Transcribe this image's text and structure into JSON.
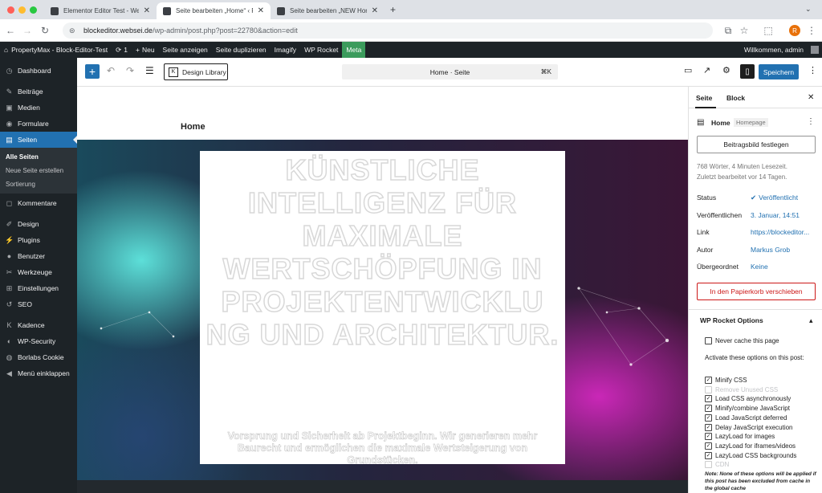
{
  "browser": {
    "tabs": [
      {
        "label": "Elementor Editor Test - Webs",
        "close": "✕"
      },
      {
        "label": "Seite bearbeiten „Home“ ‹ Pr",
        "close": "✕"
      },
      {
        "label": "Seite bearbeiten „NEW Home",
        "close": "✕"
      }
    ],
    "new_tab": "+",
    "url_host": "blockeditor.websei.de",
    "url_path": "/wp-admin/post.php?post=22780&action=edit",
    "profile_initial": "R"
  },
  "adminbar": {
    "site": "PropertyMax - Block-Editor-Test",
    "updates": "1",
    "new": "Neu",
    "view": "Seite anzeigen",
    "duplicate": "Seite duplizieren",
    "imagify": "Imagify",
    "rocket": "WP Rocket",
    "meta": "Meta",
    "welcome": "Willkommen, admin"
  },
  "sidebar": {
    "dashboard": "Dashboard",
    "posts": "Beiträge",
    "media": "Medien",
    "forms": "Formulare",
    "pages": "Seiten",
    "sub": [
      "Alle Seiten",
      "Neue Seite erstellen",
      "Sortierung"
    ],
    "comments": "Kommentare",
    "design": "Design",
    "plugins": "Plugins",
    "users": "Benutzer",
    "tools": "Werkzeuge",
    "settings": "Einstellungen",
    "seo": "SEO",
    "kadence": "Kadence",
    "security": "WP-Security",
    "borlabs": "Borlabs Cookie",
    "collapse": "Menü einklappen"
  },
  "editor": {
    "design_library": "Design Library",
    "command": "Home · Seite",
    "shortcut": "⌘K",
    "save": "Speichern"
  },
  "canvas": {
    "page_title": "Home",
    "headline": "KÜNSTLICHE INTELLIGENZ FÜR MAXIMALE WERTSCHÖPFUNG IN PROJEKTENTWICKLU NG UND ARCHITEKTUR.",
    "subline": "Vorsprung und Sicherheit ab Projektbeginn. Wir generieren mehr Baurecht und ermöglichen die maximale Wertsteigerung von Grundstücken."
  },
  "panel": {
    "tab_page": "Seite",
    "tab_block": "Block",
    "close": "✕",
    "title": "Home",
    "badge": "Homepage",
    "featured": "Beitragsbild festlegen",
    "stats": "768 Wörter, 4 Minuten Lesezeit.",
    "edited": "Zuletzt bearbeitet vor 14 Tagen.",
    "rows": [
      {
        "label": "Status",
        "value": "Veröffentlicht"
      },
      {
        "label": "Veröffentlichen",
        "value": "3. Januar, 14:51"
      },
      {
        "label": "Link",
        "value": "https://blockeditor..."
      },
      {
        "label": "Autor",
        "value": "Markus Grob"
      },
      {
        "label": "Übergeordnet",
        "value": "Keine"
      }
    ],
    "trash": "In den Papierkorb verschieben",
    "rocket_title": "WP Rocket Options",
    "never_cache": "Never cache this page",
    "activate": "Activate these options on this post:",
    "options": [
      {
        "label": "Minify CSS",
        "checked": true
      },
      {
        "label": "Remove Unused CSS",
        "checked": false,
        "disabled": true
      },
      {
        "label": "Load CSS asynchronously",
        "checked": true
      },
      {
        "label": "Minify/combine JavaScript",
        "checked": true
      },
      {
        "label": "Load JavaScript deferred",
        "checked": true
      },
      {
        "label": "Delay JavaScript execution",
        "checked": true
      },
      {
        "label": "LazyLoad for images",
        "checked": true
      },
      {
        "label": "LazyLoad for iframes/videos",
        "checked": true
      },
      {
        "label": "LazyLoad CSS backgrounds",
        "checked": true
      },
      {
        "label": "CDN",
        "checked": false,
        "disabled": true
      }
    ],
    "note": "Note: None of these options will be applied if this post has been excluded from cache in the global cache"
  },
  "colors": {
    "wp_blue": "#2271b1",
    "admin_dark": "#1d2327",
    "danger": "#cc1818",
    "meta_green": "#3b9b5c"
  }
}
